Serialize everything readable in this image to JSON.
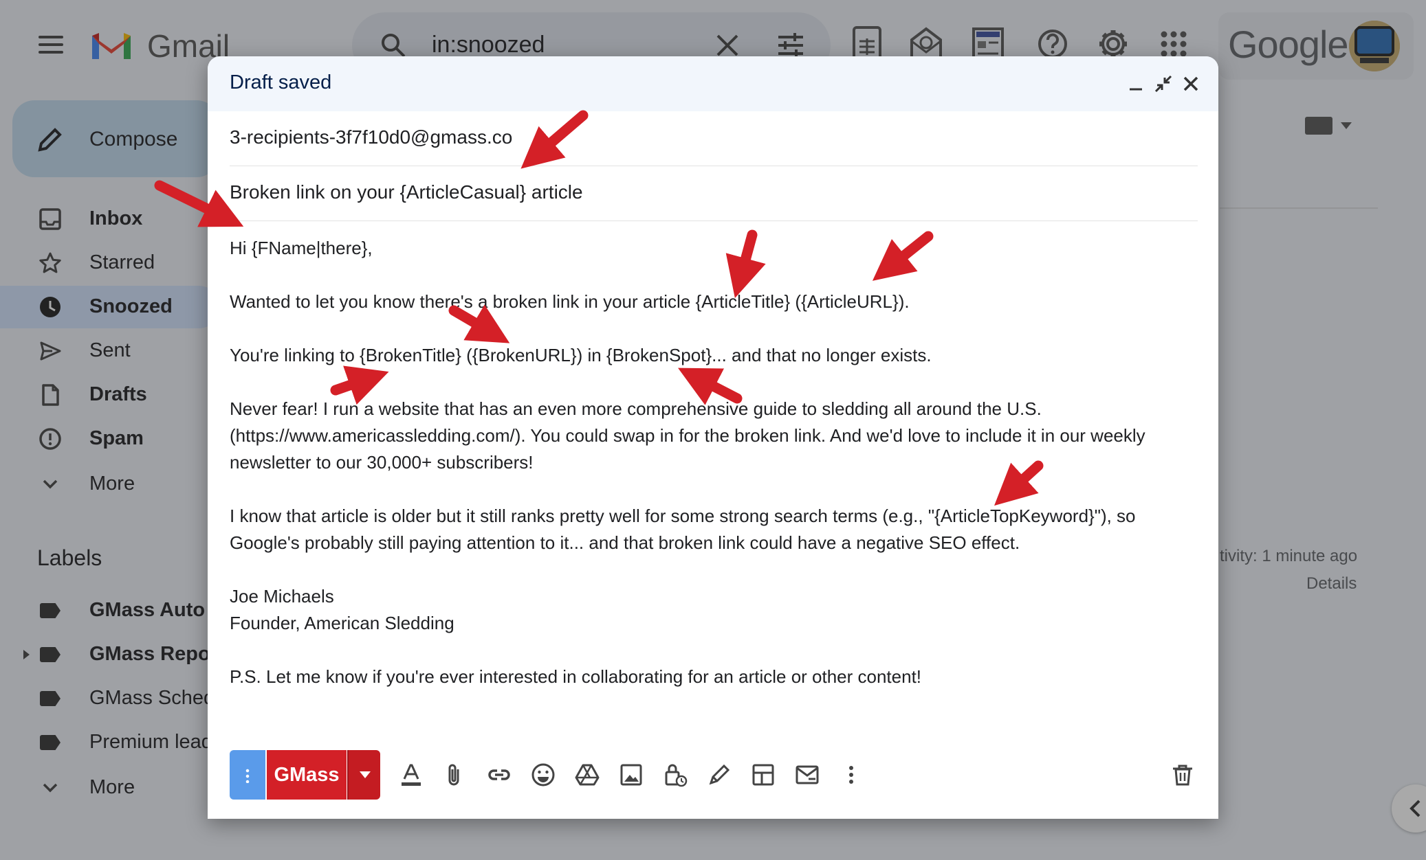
{
  "app": {
    "name": "Gmail",
    "brand_word": "Google"
  },
  "search": {
    "query": "in:snoozed"
  },
  "sidebar": {
    "compose_label": "Compose",
    "items": [
      {
        "label": "Inbox",
        "bold": true,
        "icon": "inbox-icon"
      },
      {
        "label": "Starred",
        "bold": false,
        "icon": "star-icon"
      },
      {
        "label": "Snoozed",
        "bold": true,
        "icon": "clock-icon",
        "active": true
      },
      {
        "label": "Sent",
        "bold": false,
        "icon": "send-icon"
      },
      {
        "label": "Drafts",
        "bold": true,
        "icon": "draft-icon"
      },
      {
        "label": "Spam",
        "bold": true,
        "icon": "spam-icon"
      },
      {
        "label": "More",
        "bold": false,
        "icon": "chevron-down-icon"
      }
    ],
    "labels_title": "Labels",
    "labels": [
      {
        "label": "GMass Auto",
        "bold": true
      },
      {
        "label": "GMass Repo",
        "bold": true
      },
      {
        "label": "GMass Sched",
        "bold": false
      },
      {
        "label": "Premium lead",
        "bold": false
      }
    ],
    "labels_more": "More"
  },
  "main": {
    "activity": "tivity: 1 minute ago",
    "details": "Details"
  },
  "compose": {
    "title": "Draft saved",
    "to": "3-recipients-3f7f10d0@gmass.co",
    "subject": "Broken link on your {ArticleCasual} article",
    "body": {
      "greeting": "Hi {FName|there},",
      "p1": "Wanted to let you know there's a broken link in your article {ArticleTitle} ({ArticleURL}).",
      "p2": "You're linking to {BrokenTitle} ({BrokenURL}) in {BrokenSpot}... and that no longer exists.",
      "p3_l1": "Never fear! I run a website that has an even more comprehensive guide to sledding all around the U.S.",
      "p3_l2": "(https://www.americassledding.com/). You could swap in for the broken link. And we'd love to include it in our weekly",
      "p3_l3": "newsletter to our 30,000+ subscribers!",
      "p4_l1": "I know that article is older but it still ranks pretty well for some strong search terms (e.g., \"{ArticleTopKeyword}\"), so",
      "p4_l2": "Google's probably still paying attention to it... and that broken link could have a negative SEO effect.",
      "sig_name": "Joe Michaels",
      "sig_title": "Founder, American Sledding",
      "ps": "P.S. Let me know if you're ever interested in collaborating for an article or other content!"
    },
    "send_button": "GMass"
  },
  "colors": {
    "gmass_red": "#d32027",
    "options_blue": "#5a9bea",
    "arrow_red": "#d42027"
  }
}
